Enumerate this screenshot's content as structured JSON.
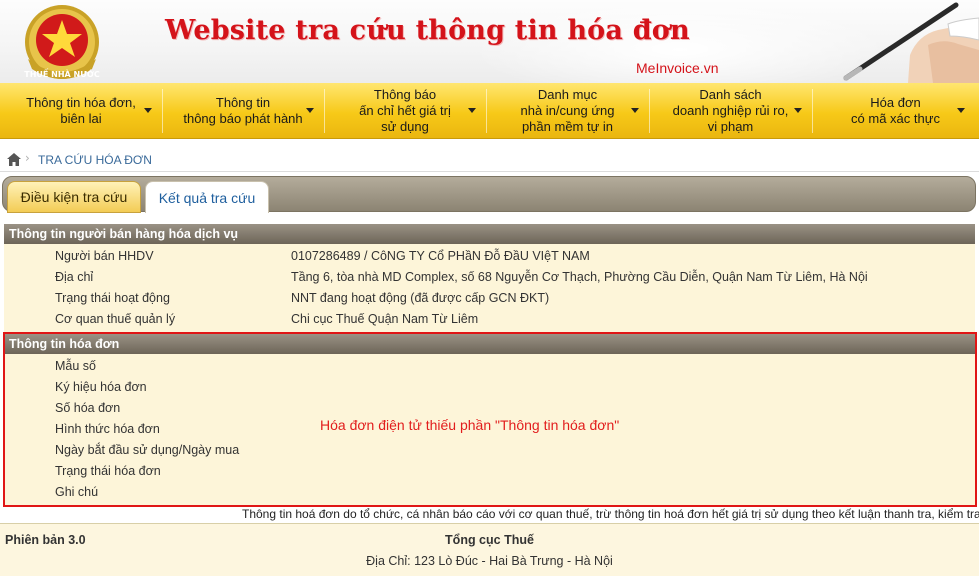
{
  "header": {
    "site_title": "Website tra cứu thông tin hóa đơn",
    "brand": "MeInvoice.vn",
    "logo_text": "THUẾ NHÀ NƯỚC"
  },
  "nav": [
    {
      "label": "Thông tin hóa đơn,\nbiên lai"
    },
    {
      "label": "Thông tin\nthông báo phát hành"
    },
    {
      "label": "Thông báo\nấn chỉ hết giá trị\nsử dụng"
    },
    {
      "label": "Danh mục\nnhà in/cung ứng\nphần mềm tự in"
    },
    {
      "label": "Danh sách\ndoanh nghiệp rủi ro,\nvi phạm"
    },
    {
      "label": "Hóa đơn\ncó mã xác thực"
    }
  ],
  "breadcrumb": {
    "current": "TRA CỨU HÓA ĐƠN"
  },
  "tabs": [
    {
      "label": "Điều kiện tra cứu"
    },
    {
      "label": "Kết quả tra cứu"
    }
  ],
  "seller": {
    "title": "Thông tin người bán hàng hóa dịch vụ",
    "rows": [
      {
        "key": "Người bán HHDV",
        "value": "0107286489 / CôNG TY Cổ PHầN Đỗ ĐầU VIệT NAM"
      },
      {
        "key": "Địa chỉ",
        "value": "Tầng 6, tòa nhà MD Complex, số 68 Nguyễn Cơ Thạch, Phường Cầu Diễn, Quận Nam Từ Liêm, Hà Nội"
      },
      {
        "key": "Trạng thái hoạt động",
        "value": "NNT đang hoạt động (đã được cấp GCN ĐKT)"
      },
      {
        "key": "Cơ quan thuế quản lý",
        "value": "Chi cục Thuế Quận Nam Từ Liêm"
      }
    ]
  },
  "invoice": {
    "title": "Thông tin hóa đơn",
    "rows": [
      {
        "key": "Mẫu số"
      },
      {
        "key": "Ký hiệu hóa đơn"
      },
      {
        "key": "Số hóa đơn"
      },
      {
        "key": "Hình thức hóa đơn"
      },
      {
        "key": "Ngày bắt đầu sử dụng/Ngày mua"
      },
      {
        "key": "Trạng thái hóa đơn"
      },
      {
        "key": "Ghi chú"
      }
    ],
    "annotation": "Hóa đơn điện tử thiếu phần \"Thông tin hóa đơn\""
  },
  "disclaimer": "Thông tin hoá đơn do tổ chức, cá nhân báo cáo với cơ quan thuế, trừ thông tin hoá đơn hết giá trị sử dụng theo kết luận thanh tra, kiểm tra",
  "footer": {
    "version": "Phiên bản 3.0",
    "org": "Tổng cục Thuế",
    "address": "Địa Chỉ: 123 Lò Đúc - Hai Bà Trưng - Hà Nội"
  },
  "colors": {
    "title_red": "#d4131a",
    "nav_yellow": "#f7c918",
    "annotation_red": "#e01616"
  }
}
